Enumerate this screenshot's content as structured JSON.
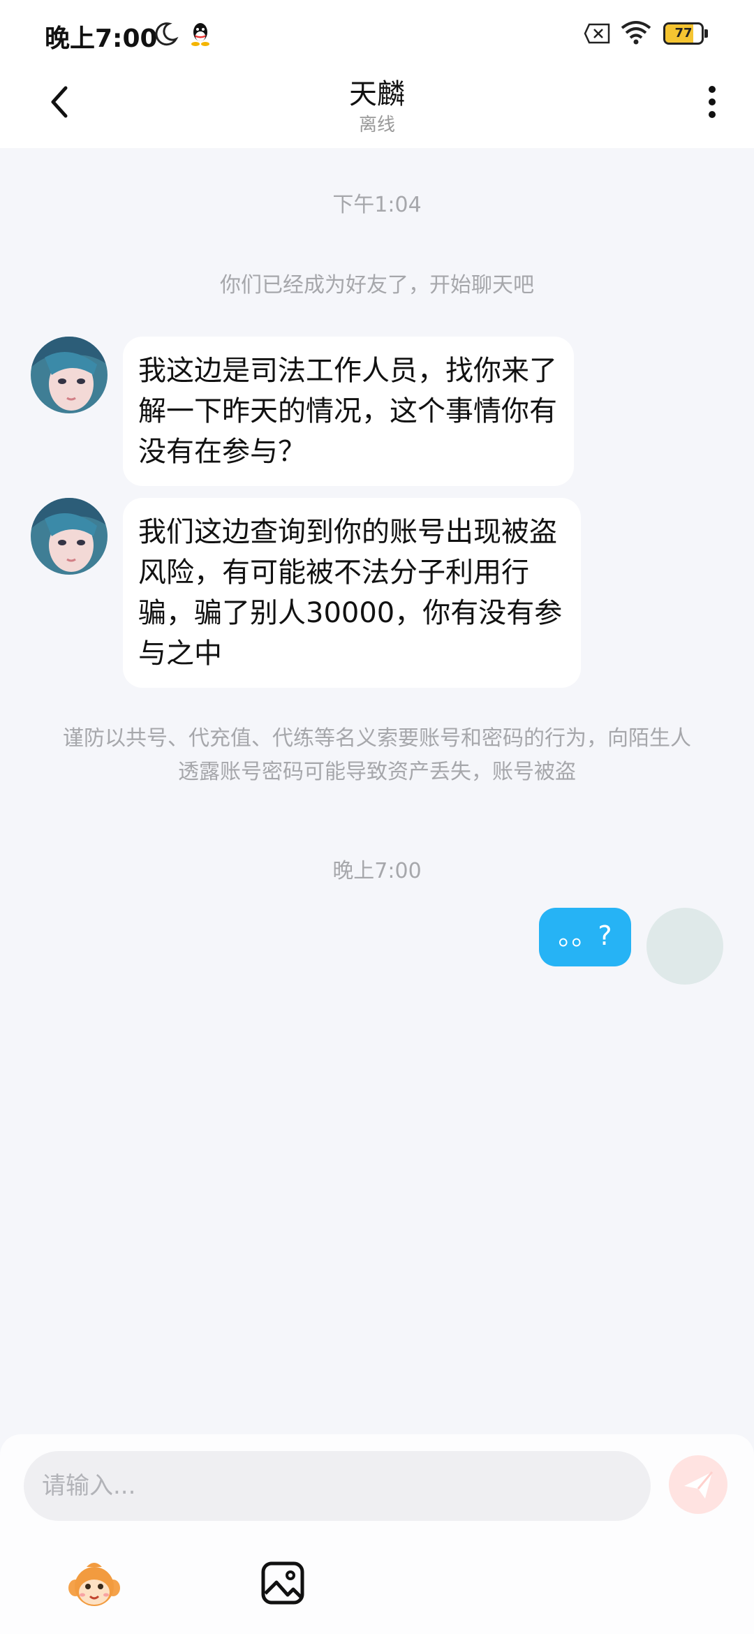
{
  "status_bar": {
    "time": "晚上7:00",
    "battery_level": "77",
    "battery_fraction": 0.77,
    "icons": [
      "moon-icon",
      "qq-icon",
      "sim-icon",
      "wifi-icon",
      "battery-icon"
    ]
  },
  "header": {
    "title": "天麟",
    "subtitle": "离线",
    "icons": [
      "back-arrow-icon",
      "more-vertical-icon"
    ]
  },
  "chat": {
    "timestamp_1": "下午1:04",
    "friend_notice": "你们已经成为好友了，开始聊天吧",
    "messages": [
      {
        "side": "left",
        "text": "我这边是司法工作人员，找你来了解一下昨天的情况，这个事情你有没有在参与？"
      },
      {
        "side": "left",
        "text": "我们这边查询到你的账号出现被盗风险，有可能被不法分子利用行骗，骗了别人30000，你有没有参与之中"
      }
    ],
    "warning": "谨防以共号、代充值、代练等名义索要账号和密码的行为，向陌生人透露账号密码可能导致资产丢失，账号被盗",
    "timestamp_2": "晚上7:00",
    "my_message": "。。?"
  },
  "input": {
    "placeholder": "请输入...",
    "value": "",
    "icons": [
      "send-icon",
      "emoji-monkey-icon",
      "image-icon"
    ]
  },
  "colors": {
    "background": "#f5f6fa",
    "my_bubble": "#26b3f5",
    "send_button": "#ffe3e1",
    "system_text": "#a6a7ab"
  }
}
